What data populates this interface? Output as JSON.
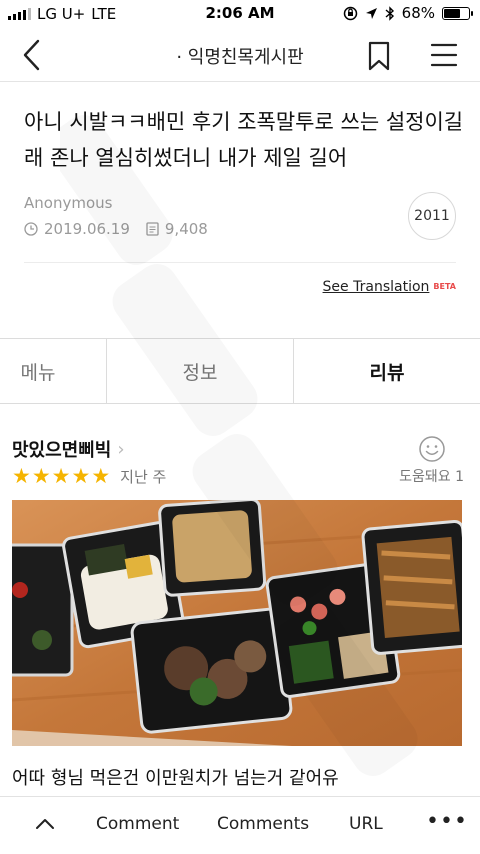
{
  "status_bar": {
    "carrier": "LG U+",
    "network": "LTE",
    "time": "2:06 AM",
    "battery_percent": "68%",
    "battery_level": 0.68
  },
  "nav": {
    "title": "· 익명친목게시판",
    "icons": [
      "back-arrow-icon",
      "bookmark-icon",
      "menu-icon"
    ]
  },
  "post": {
    "title": "아니 시발ㅋㅋ배민 후기 조폭말투로 쓰는 설정이길래 존나 열심히썼더니 내가 제일 길어",
    "author": "Anonymous",
    "date": "2019.06.19",
    "views": "9,408",
    "year_badge": "2011",
    "see_translation": "See Translation",
    "beta_label": "BETA"
  },
  "screenshot_tabs": [
    "메뉴",
    "정보",
    "리뷰"
  ],
  "review": {
    "reviewer": "맛있으면삐빅",
    "stars": 5,
    "time": "지난 주",
    "helpful": "도움돼요 1",
    "text": "어따 형님 먹은건 이만원치가 넘는거 같어유"
  },
  "toolbar": {
    "comment": "Comment",
    "comments": "Comments",
    "url": "URL",
    "more": "•••"
  },
  "colors": {
    "star": "#f5b400",
    "beta": "#e84a4a",
    "muted_text": "#9a9a9a"
  }
}
